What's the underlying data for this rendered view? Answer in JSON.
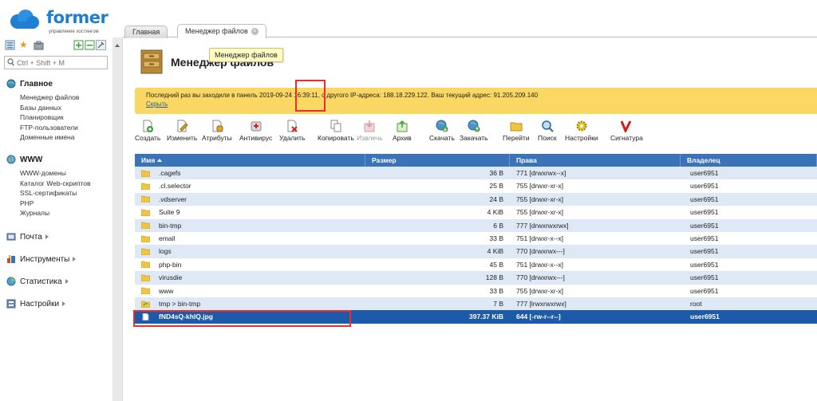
{
  "logo": {
    "name": "former",
    "subtitle": "управление хостингом"
  },
  "search": {
    "placeholder": "Ctrl + Shift + M"
  },
  "sidebar": {
    "main": {
      "label": "Главное",
      "items": [
        "Менеджер файлов",
        "Базы данных",
        "Планировщик",
        "FTP-пользователи",
        "Доменные имена"
      ]
    },
    "www": {
      "label": "WWW",
      "items": [
        "WWW-домены",
        "Каталог Web-скриптов",
        "SSL-сертификаты",
        "PHP",
        "Журналы"
      ]
    },
    "mail": {
      "label": "Почта"
    },
    "tools": {
      "label": "Инструменты"
    },
    "stats": {
      "label": "Статистика"
    },
    "settings": {
      "label": "Настройки"
    }
  },
  "tabs": [
    {
      "label": "Главная"
    },
    {
      "label": "Менеджер файлов"
    }
  ],
  "page": {
    "title": "Менеджер файлов",
    "tooltip": "Менеджер файлов"
  },
  "notice": {
    "text": "Последний раз вы заходили в панель 2019-09-24 16:39:11, с другого IP-адреса: 188.18.229.122. Ваш текущий адрес: 91.205.209.140",
    "hide": "Скрыть"
  },
  "actions": {
    "create": "Создать",
    "edit": "Изменить",
    "attributes": "Атрибуты",
    "antivirus": "Антивирус",
    "delete": "Удалить",
    "copy": "Копировать",
    "extract": "Извлечь",
    "archive": "Архив",
    "download": "Скачать",
    "upload": "Закачать",
    "goto": "Перейти",
    "search": "Поиск",
    "settings": "Настройки",
    "signature": "Сигнатура"
  },
  "table": {
    "headers": {
      "name": "Имя",
      "size": "Размер",
      "perms": "Права",
      "owner": "Владелец"
    },
    "rows": [
      {
        "name": ".cagefs",
        "size": "36 B",
        "perms": "771 [drwxrwx--x]",
        "owner": "user6951"
      },
      {
        "name": ".cl.selector",
        "size": "25 B",
        "perms": "755 [drwxr-xr-x]",
        "owner": "user6951"
      },
      {
        "name": ".vdserver",
        "size": "24 B",
        "perms": "755 [drwxr-xr-x]",
        "owner": "user6951"
      },
      {
        "name": "Suite 9",
        "size": "4 KiB",
        "perms": "755 [drwxr-xr-x]",
        "owner": "user6951"
      },
      {
        "name": "bin-tmp",
        "size": "6 B",
        "perms": "777 [drwxrwxrwx]",
        "owner": "user6951"
      },
      {
        "name": "email",
        "size": "33 B",
        "perms": "751 [drwxr-x--x]",
        "owner": "user6951"
      },
      {
        "name": "logs",
        "size": "4 KiB",
        "perms": "770 [drwxrwx---]",
        "owner": "user6951"
      },
      {
        "name": "php-bin",
        "size": "45 B",
        "perms": "751 [drwxr-x--x]",
        "owner": "user6951"
      },
      {
        "name": "virusdie",
        "size": "128 B",
        "perms": "770 [drwxrwx---]",
        "owner": "user6951"
      },
      {
        "name": "www",
        "size": "33 B",
        "perms": "755 [drwxr-xr-x]",
        "owner": "user6951"
      },
      {
        "name": "tmp > bin-tmp",
        "size": "7 B",
        "perms": "777 [lrwxrwxrwx]",
        "owner": "root"
      },
      {
        "name": "fND4sQ-khlQ.jpg",
        "size": "397.37 KiB",
        "perms": "644 [-rw-r--r--]",
        "owner": "user6951"
      }
    ]
  },
  "colors": {
    "accent": "#3b73b9",
    "selected": "#1d5aa9",
    "notice": "#fbd864",
    "highlight": "#e53030"
  }
}
